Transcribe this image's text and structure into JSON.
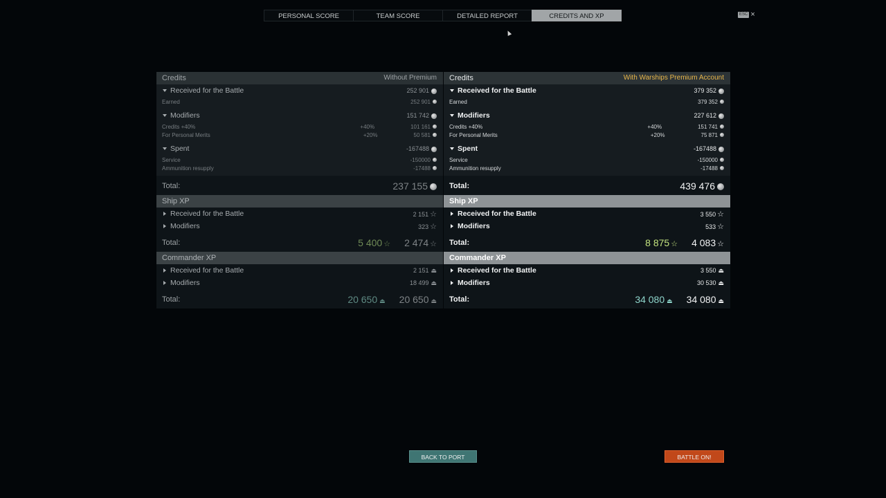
{
  "tabs": [
    {
      "label": "PERSONAL SCORE"
    },
    {
      "label": "TEAM SCORE"
    },
    {
      "label": "DETAILED REPORT"
    },
    {
      "label": "CREDITS AND XP"
    }
  ],
  "esc_label": "ESC",
  "close_glyph": "×",
  "without_premium": {
    "credits_title": "Credits",
    "credits_note": "Without Premium",
    "received_label": "Received for the Battle",
    "received_value": "252 901",
    "earned_label": "Earned",
    "earned_value": "252 901",
    "modifiers_label": "Modifiers",
    "modifiers_value": "151 742",
    "credits_bonus_label": "Credits +40%",
    "credits_bonus_pct": "+40%",
    "credits_bonus_value": "101 161",
    "merits_label": "For Personal Merits",
    "merits_pct": "+20%",
    "merits_value": "50 581",
    "spent_label": "Spent",
    "spent_value": "-167488",
    "service_label": "Service",
    "service_value": "-150000",
    "ammo_label": "Ammunition resupply",
    "ammo_value": "-17488",
    "total_label": "Total:",
    "credits_total": "237 155",
    "ship_xp_title": "Ship XP",
    "ship_received_label": "Received for the Battle",
    "ship_received_value": "2 151",
    "ship_modifiers_label": "Modifiers",
    "ship_modifiers_value": "323",
    "ship_total_free": "5 400",
    "ship_total": "2 474",
    "cmd_xp_title": "Commander XP",
    "cmd_received_label": "Received for the Battle",
    "cmd_received_value": "2 151",
    "cmd_modifiers_label": "Modifiers",
    "cmd_modifiers_value": "18 499",
    "cmd_total_a": "20 650",
    "cmd_total_b": "20 650"
  },
  "with_premium": {
    "credits_title": "Credits",
    "credits_note": "With Warships Premium Account",
    "received_label": "Received for the Battle",
    "received_value": "379 352",
    "earned_label": "Earned",
    "earned_value": "379 352",
    "modifiers_label": "Modifiers",
    "modifiers_value": "227 612",
    "credits_bonus_label": "Credits +40%",
    "credits_bonus_pct": "+40%",
    "credits_bonus_value": "151 741",
    "merits_label": "For Personal Merits",
    "merits_pct": "+20%",
    "merits_value": "75 871",
    "spent_label": "Spent",
    "spent_value": "-167488",
    "service_label": "Service",
    "service_value": "-150000",
    "ammo_label": "Ammunition resupply",
    "ammo_value": "-17488",
    "total_label": "Total:",
    "credits_total": "439 476",
    "ship_xp_title": "Ship XP",
    "ship_received_label": "Received for the Battle",
    "ship_received_value": "3 550",
    "ship_modifiers_label": "Modifiers",
    "ship_modifiers_value": "533",
    "ship_total_free": "8 875",
    "ship_total": "4 083",
    "cmd_xp_title": "Commander XP",
    "cmd_received_label": "Received for the Battle",
    "cmd_received_value": "3 550",
    "cmd_modifiers_label": "Modifiers",
    "cmd_modifiers_value": "30 530",
    "cmd_total_a": "34 080",
    "cmd_total_b": "34 080"
  },
  "buttons": {
    "back_to_port": "BACK TO PORT",
    "battle": "BATTLE ON!"
  },
  "colors": {
    "premium_gold": "#e8b64a",
    "free_xp_green": "#c3e37f",
    "commander_teal": "#8fd6cc",
    "port_button": "#3f7573",
    "battle_button": "#c1481a"
  },
  "icons": [
    "credits-coin-icon",
    "xp-star-icon",
    "commander-xp-icon",
    "close-icon",
    "expand-arrow-icon",
    "collapse-arrow-icon"
  ]
}
